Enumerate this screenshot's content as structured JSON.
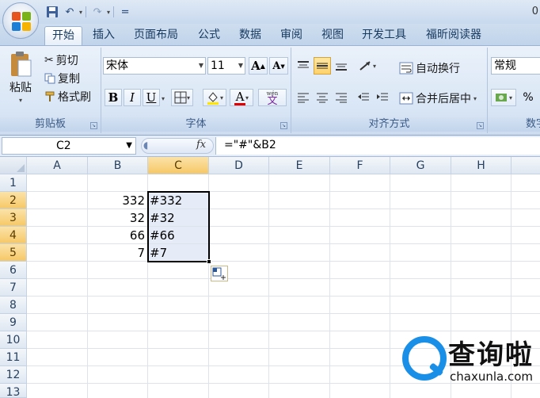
{
  "titlebar": {
    "number": "0",
    "qat_separator": "="
  },
  "tabs": [
    "开始",
    "插入",
    "页面布局",
    "公式",
    "数据",
    "审阅",
    "视图",
    "开发工具",
    "福昕阅读器"
  ],
  "ribbon": {
    "clipboard": {
      "label": "剪贴板",
      "paste": "粘贴",
      "cut": "剪切",
      "copy": "复制",
      "format_painter": "格式刷"
    },
    "font": {
      "label": "字体",
      "font_name": "宋体",
      "font_size": "11",
      "bold": "B",
      "italic": "I",
      "underline": "U",
      "grow": "A",
      "shrink": "A",
      "font_color": "A",
      "wen": "wén",
      "phonetic": "文"
    },
    "alignment": {
      "label": "对齐方式",
      "wrap_text": "自动换行",
      "merge_center": "合并后居中"
    },
    "number": {
      "label": "数字",
      "format": "常规",
      "percent": "%"
    }
  },
  "formula_bar": {
    "name_box": "C2",
    "fx": "fx",
    "formula": "=\"#\"&B2"
  },
  "sheet": {
    "columns": [
      "A",
      "B",
      "C",
      "D",
      "E",
      "F",
      "G",
      "H"
    ],
    "rows": [
      "1",
      "2",
      "3",
      "4",
      "5",
      "6",
      "7",
      "8",
      "9",
      "10",
      "11",
      "12",
      "13"
    ],
    "cells": {
      "B2": "332",
      "B3": "32",
      "B4": "66",
      "B5": "7",
      "C2": "#332",
      "C3": "#32",
      "C4": "#66",
      "C5": "#7"
    }
  },
  "watermark": {
    "cn": "查询啦",
    "en": "chaxunla.com"
  },
  "colors": {
    "accent_blue": "#1a8fe8",
    "selection_header": "#f6c866",
    "ribbon_bg": "#dbe7f6"
  }
}
